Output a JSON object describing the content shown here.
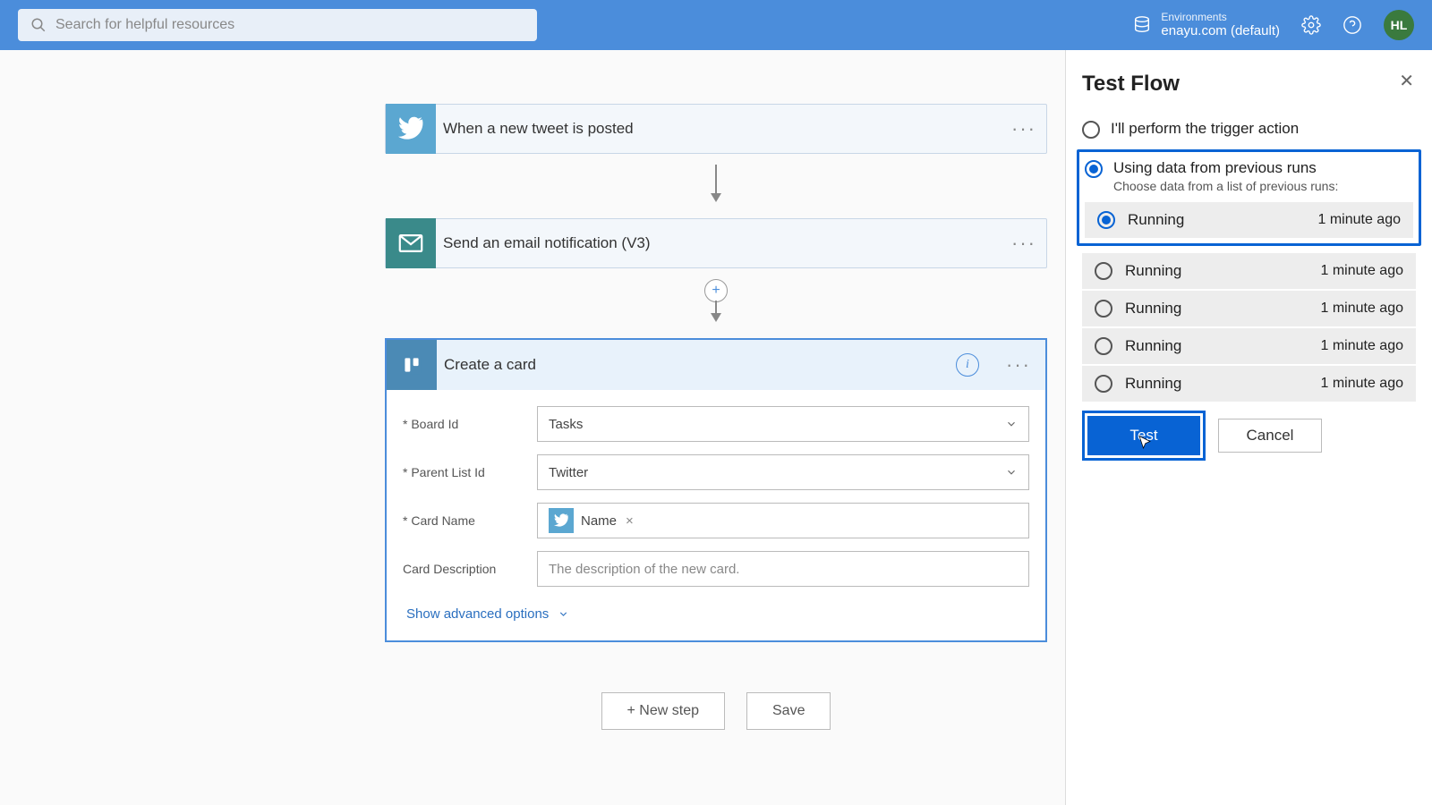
{
  "header": {
    "search_placeholder": "Search for helpful resources",
    "environments_label": "Environments",
    "environment_value": "enayu.com (default)",
    "avatar_initials": "HL"
  },
  "flow": {
    "trigger": {
      "title": "When a new tweet is posted"
    },
    "action1": {
      "title": "Send an email notification (V3)"
    },
    "action2": {
      "title": "Create a card",
      "fields": {
        "board_label": "* Board Id",
        "board_value": "Tasks",
        "list_label": "* Parent List Id",
        "list_value": "Twitter",
        "name_label": "* Card Name",
        "name_token": "Name",
        "desc_label": "Card Description",
        "desc_placeholder": "The description of the new card."
      },
      "advanced_label": "Show advanced options"
    },
    "buttons": {
      "new_step": "+ New step",
      "save": "Save"
    }
  },
  "panel": {
    "title": "Test Flow",
    "opt_perform": "I'll perform the trigger action",
    "opt_previous": "Using data from previous runs",
    "opt_previous_sub": "Choose data from a list of previous runs:",
    "runs": [
      {
        "status": "Running",
        "time": "1 minute ago",
        "selected": true
      },
      {
        "status": "Running",
        "time": "1 minute ago",
        "selected": false
      },
      {
        "status": "Running",
        "time": "1 minute ago",
        "selected": false
      },
      {
        "status": "Running",
        "time": "1 minute ago",
        "selected": false
      },
      {
        "status": "Running",
        "time": "1 minute ago",
        "selected": false
      }
    ],
    "test_btn": "Test",
    "cancel_btn": "Cancel"
  }
}
